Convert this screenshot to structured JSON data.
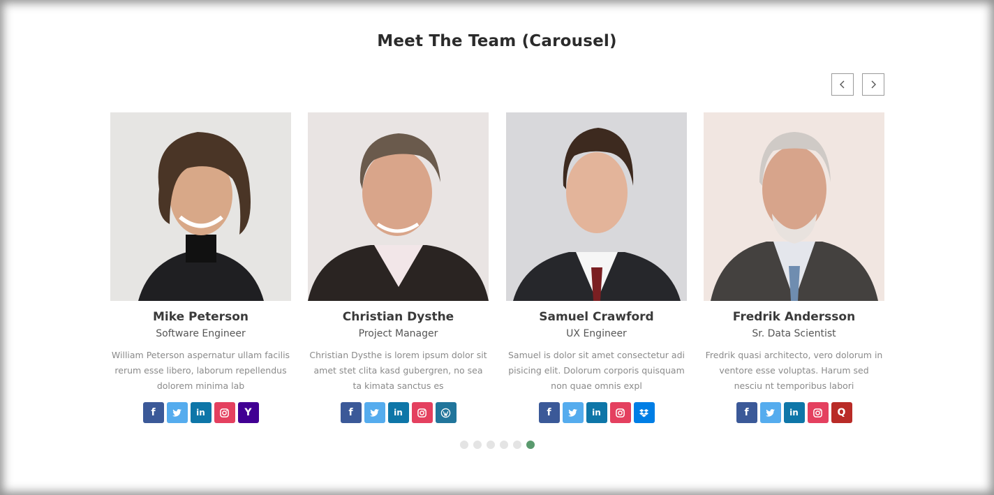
{
  "title": "Meet The Team (Carousel)",
  "nav": {
    "prev_icon": "chevron-left-icon",
    "next_icon": "chevron-right-icon"
  },
  "members": [
    {
      "name": "Mike Peterson",
      "role": "Software Engineer",
      "bio": "William Peterson aspernatur ullam facilis rerum esse libero, laborum repellendus dolorem minima lab",
      "socials": [
        {
          "type": "facebook",
          "glyph": "f"
        },
        {
          "type": "twitter",
          "glyph": ""
        },
        {
          "type": "linkedin",
          "glyph": "in"
        },
        {
          "type": "instagram",
          "glyph": ""
        },
        {
          "type": "yahoo",
          "glyph": "Y"
        }
      ]
    },
    {
      "name": "Christian Dysthe",
      "role": "Project Manager",
      "bio": "Christian Dysthe is lorem ipsum dolor sit amet stet clita kasd gubergren, no sea ta kimata sanctus es",
      "socials": [
        {
          "type": "facebook",
          "glyph": "f"
        },
        {
          "type": "twitter",
          "glyph": ""
        },
        {
          "type": "linkedin",
          "glyph": "in"
        },
        {
          "type": "instagram",
          "glyph": ""
        },
        {
          "type": "wordpress",
          "glyph": ""
        }
      ]
    },
    {
      "name": "Samuel Crawford",
      "role": "UX Engineer",
      "bio": "Samuel is dolor sit amet consectetur adi pisicing elit. Dolorum corporis quisquam non quae omnis expl",
      "socials": [
        {
          "type": "facebook",
          "glyph": "f"
        },
        {
          "type": "twitter",
          "glyph": ""
        },
        {
          "type": "linkedin",
          "glyph": "in"
        },
        {
          "type": "instagram",
          "glyph": ""
        },
        {
          "type": "dropbox",
          "glyph": ""
        }
      ]
    },
    {
      "name": "Fredrik Andersson",
      "role": "Sr. Data Scientist",
      "bio": "Fredrik quasi architecto, vero dolorum in ventore esse voluptas. Harum sed nesciu nt temporibus labori",
      "socials": [
        {
          "type": "facebook",
          "glyph": "f"
        },
        {
          "type": "twitter",
          "glyph": ""
        },
        {
          "type": "linkedin",
          "glyph": "in"
        },
        {
          "type": "instagram",
          "glyph": ""
        },
        {
          "type": "quora",
          "glyph": "Q"
        }
      ]
    }
  ],
  "pagination": {
    "count": 6,
    "active_index": 5,
    "active_color": "#5a9a6e",
    "inactive_color": "#e4e4e4"
  },
  "colors": {
    "facebook": "#3b5998",
    "twitter": "#55acee",
    "linkedin": "#0e76a8",
    "instagram": "#e4405f",
    "yahoo": "#410093",
    "wordpress": "#21759b",
    "dropbox": "#007ee5",
    "quora": "#b92b27"
  }
}
